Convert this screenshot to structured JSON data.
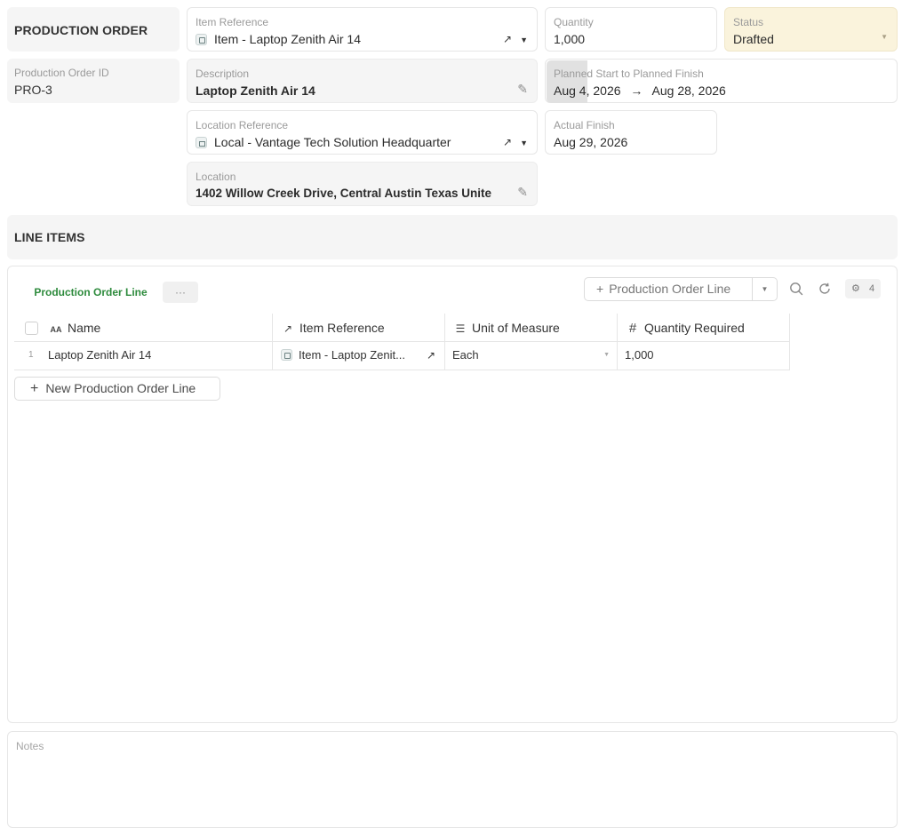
{
  "header": {
    "title": "PRODUCTION ORDER",
    "id_label": "Production Order ID",
    "id_value": "PRO-3"
  },
  "fields": {
    "item_reference": {
      "label": "Item Reference",
      "value": "Item - Laptop Zenith Air 14"
    },
    "quantity": {
      "label": "Quantity",
      "value": "1,000"
    },
    "status": {
      "label": "Status",
      "value": "Drafted"
    },
    "description": {
      "label": "Description",
      "value": "Laptop Zenith Air 14"
    },
    "planned": {
      "label": "Planned Start to Planned Finish",
      "start": "Aug 4, 2026",
      "finish": "Aug 28, 2026"
    },
    "location_reference": {
      "label": "Location Reference",
      "value": "Local - Vantage Tech Solution Headquarter"
    },
    "actual_finish": {
      "label": "Actual Finish",
      "value": "Aug 29, 2026"
    },
    "location": {
      "label": "Location",
      "value": "1402 Willow Creek Drive, Central  Austin Texas Unite"
    }
  },
  "line_items": {
    "title": "LINE ITEMS",
    "tab_label": "Production Order Line",
    "more_label": "···",
    "add_button_label": "Production Order Line",
    "filter_count": "4",
    "columns": [
      {
        "label": "Name",
        "icon": "AA"
      },
      {
        "label": "Item Reference",
        "icon": "↗"
      },
      {
        "label": "Unit of Measure",
        "icon": "☰"
      },
      {
        "label": "Quantity Required",
        "icon": "#"
      }
    ],
    "rows": [
      {
        "index": "1",
        "name": "Laptop Zenith Air 14",
        "item_reference": "Item - Laptop Zenit...",
        "unit": "Each",
        "quantity": "1,000"
      }
    ],
    "new_button_label": "New Production Order Line"
  },
  "notes": {
    "label": "Notes"
  },
  "colors": {
    "accent_green": "#2e8b3d",
    "status_bg": "#faf3dc"
  }
}
